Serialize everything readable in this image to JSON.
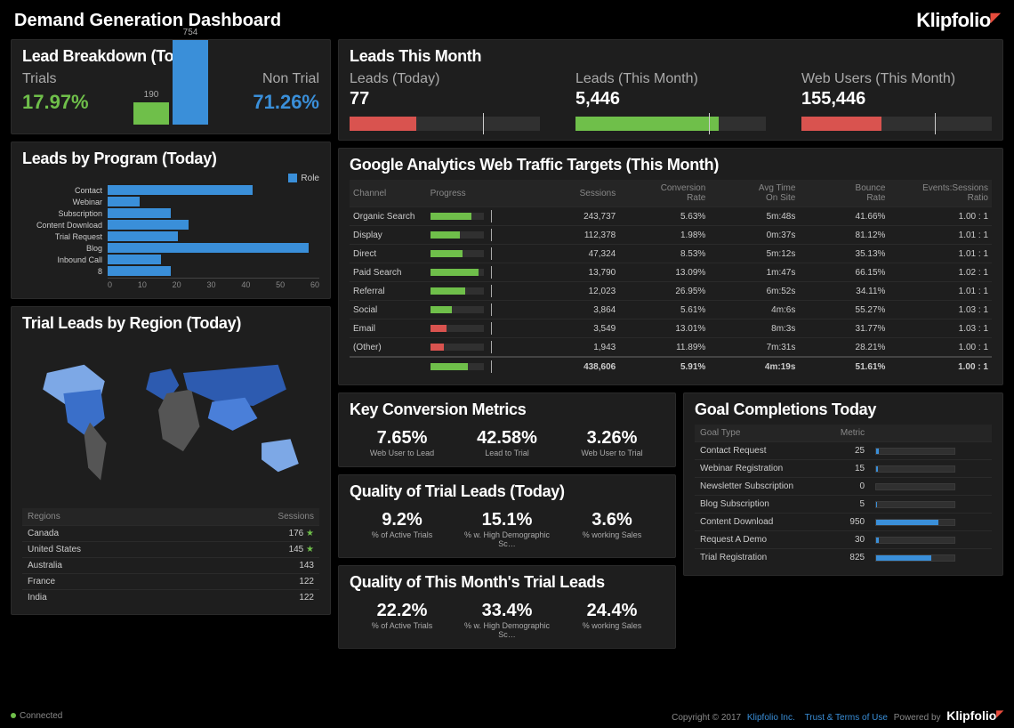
{
  "header": {
    "title": "Demand Generation Dashboard",
    "brand": "Klipfolio"
  },
  "lead_breakdown": {
    "title": "Lead Breakdown (Today)",
    "trials_label": "Trials",
    "trials_pct": "17.97%",
    "nontrial_label": "Non Trial",
    "nontrial_pct": "71.26%",
    "bars": {
      "trial": 190,
      "nontrial": 754
    }
  },
  "leads_by_program": {
    "title": "Leads by Program (Today)",
    "legend": "Role",
    "items": [
      {
        "label": "Contact",
        "value": 41
      },
      {
        "label": "Webinar",
        "value": 9
      },
      {
        "label": "Subscription",
        "value": 18
      },
      {
        "label": "Content Download",
        "value": 23
      },
      {
        "label": "Trial Request",
        "value": 20
      },
      {
        "label": "Blog",
        "value": 57
      },
      {
        "label": "Inbound Call",
        "value": 15
      },
      {
        "label": "8",
        "value": 18
      }
    ],
    "axis": [
      "0",
      "10",
      "20",
      "30",
      "40",
      "50",
      "60"
    ]
  },
  "chart_data": [
    {
      "type": "bar",
      "title": "Lead Breakdown (Today)",
      "categories": [
        "Trials",
        "Non Trial"
      ],
      "values": [
        190,
        754
      ]
    },
    {
      "type": "bar",
      "title": "Leads by Program (Today)",
      "categories": [
        "Contact",
        "Webinar",
        "Subscription",
        "Content Download",
        "Trial Request",
        "Blog",
        "Inbound Call",
        "8"
      ],
      "values": [
        41,
        9,
        18,
        23,
        20,
        57,
        15,
        18
      ],
      "xlim": [
        0,
        60
      ]
    }
  ],
  "regions": {
    "title": "Trial Leads by Region (Today)",
    "headers": [
      "Regions",
      "Sessions"
    ],
    "rows": [
      {
        "region": "Canada",
        "sessions": "176",
        "star": true
      },
      {
        "region": "United States",
        "sessions": "145",
        "star": true
      },
      {
        "region": "Australia",
        "sessions": "143",
        "star": false
      },
      {
        "region": "France",
        "sessions": "122",
        "star": false
      },
      {
        "region": "India",
        "sessions": "122",
        "star": false
      }
    ]
  },
  "leads_month": {
    "title": "Leads This Month",
    "kpis": [
      {
        "label": "Leads (Today)",
        "value": "77",
        "fill": 35,
        "color": "r",
        "tick": 70
      },
      {
        "label": "Leads (This Month)",
        "value": "5,446",
        "fill": 75,
        "color": "g",
        "tick": 70
      },
      {
        "label": "Web Users (This Month)",
        "value": "155,446",
        "fill": 42,
        "color": "r",
        "tick": 70
      }
    ]
  },
  "ga": {
    "title": "Google Analytics Web Traffic Targets (This Month)",
    "headers": [
      "Channel",
      "Progress",
      "Sessions",
      "Conversion Rate",
      "Avg Time On Site",
      "Bounce Rate",
      "Events:Sessions Ratio"
    ],
    "rows": [
      {
        "channel": "Organic Search",
        "pfill": 78,
        "pcolor": "g",
        "sessions": "243,737",
        "conv": "5.63%",
        "time": "5m:48s",
        "bounce": "41.66%",
        "ratio": "1.00 : 1"
      },
      {
        "channel": "Display",
        "pfill": 55,
        "pcolor": "g",
        "sessions": "112,378",
        "conv": "1.98%",
        "time": "0m:37s",
        "bounce": "81.12%",
        "ratio": "1.01 : 1"
      },
      {
        "channel": "Direct",
        "pfill": 60,
        "pcolor": "g",
        "sessions": "47,324",
        "conv": "8.53%",
        "time": "5m:12s",
        "bounce": "35.13%",
        "ratio": "1.01 : 1"
      },
      {
        "channel": "Paid Search",
        "pfill": 90,
        "pcolor": "g",
        "sessions": "13,790",
        "conv": "13.09%",
        "time": "1m:47s",
        "bounce": "66.15%",
        "ratio": "1.02 : 1"
      },
      {
        "channel": "Referral",
        "pfill": 65,
        "pcolor": "g",
        "sessions": "12,023",
        "conv": "26.95%",
        "time": "6m:52s",
        "bounce": "34.11%",
        "ratio": "1.01 : 1"
      },
      {
        "channel": "Social",
        "pfill": 40,
        "pcolor": "g",
        "sessions": "3,864",
        "conv": "5.61%",
        "time": "4m:6s",
        "bounce": "55.27%",
        "ratio": "1.03 : 1"
      },
      {
        "channel": "Email",
        "pfill": 30,
        "pcolor": "r",
        "sessions": "3,549",
        "conv": "13.01%",
        "time": "8m:3s",
        "bounce": "31.77%",
        "ratio": "1.03 : 1"
      },
      {
        "channel": "(Other)",
        "pfill": 25,
        "pcolor": "r",
        "sessions": "1,943",
        "conv": "11.89%",
        "time": "7m:31s",
        "bounce": "28.21%",
        "ratio": "1.00 : 1"
      }
    ],
    "totals": {
      "pfill": 70,
      "pcolor": "g",
      "sessions": "438,606",
      "conv": "5.91%",
      "time": "4m:19s",
      "bounce": "51.61%",
      "ratio": "1.00 : 1"
    }
  },
  "kcm": {
    "title": "Key Conversion Metrics",
    "items": [
      {
        "v": "7.65%",
        "l": "Web User to Lead"
      },
      {
        "v": "42.58%",
        "l": "Lead to Trial"
      },
      {
        "v": "3.26%",
        "l": "Web User to Trial"
      }
    ]
  },
  "qtl_today": {
    "title": "Quality of Trial Leads (Today)",
    "items": [
      {
        "v": "9.2%",
        "l": "% of Active Trials"
      },
      {
        "v": "15.1%",
        "l": "% w. High Demographic Sc…"
      },
      {
        "v": "3.6%",
        "l": "% working Sales"
      }
    ]
  },
  "qtl_month": {
    "title": "Quality of This Month's Trial Leads",
    "items": [
      {
        "v": "22.2%",
        "l": "% of Active Trials"
      },
      {
        "v": "33.4%",
        "l": "% w. High Demographic Sc…"
      },
      {
        "v": "24.4%",
        "l": "% working Sales"
      }
    ]
  },
  "goals": {
    "title": "Goal Completions Today",
    "headers": [
      "Goal Type",
      "Metric"
    ],
    "rows": [
      {
        "type": "Contact Request",
        "metric": "25",
        "bar": 3
      },
      {
        "type": "Webinar Registration",
        "metric": "15",
        "bar": 2
      },
      {
        "type": "Newsletter Subscription",
        "metric": "0",
        "bar": 0
      },
      {
        "type": "Blog Subscription",
        "metric": "5",
        "bar": 1
      },
      {
        "type": "Content Download",
        "metric": "950",
        "bar": 80
      },
      {
        "type": "Request A Demo",
        "metric": "30",
        "bar": 3
      },
      {
        "type": "Trial Registration",
        "metric": "825",
        "bar": 70
      }
    ]
  },
  "footer": {
    "connected": "Connected",
    "copyright": "Copyright © 2017",
    "company": "Klipfolio Inc.",
    "terms": "Trust & Terms of Use",
    "powered": "Powered by"
  }
}
